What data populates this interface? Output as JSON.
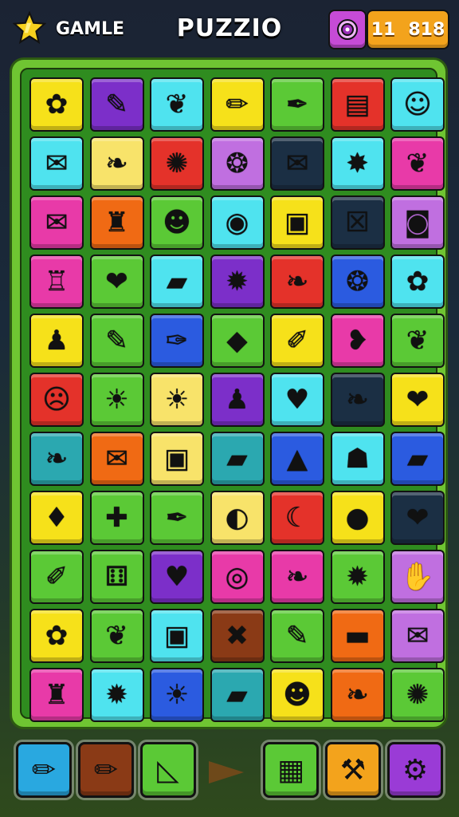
{
  "header": {
    "app_label": "GAMLE",
    "title": "PUZZIO",
    "score_left": "11",
    "score_right": "818",
    "star_icon": "star-icon",
    "ring_icon": "ring-target-icon"
  },
  "colors": {
    "yellow": "#f6e11a",
    "purple": "#7c2fc9",
    "cyan": "#4fe3ef",
    "green": "#5bc936",
    "red": "#e4322a",
    "orange": "#f06a14",
    "blue": "#2b5be0",
    "magenta": "#e83aa8",
    "navy": "#1b2f44",
    "teal": "#2ba8b0",
    "lavender": "#c06fe0",
    "cream": "#f8e36a",
    "brown": "#8a3a16",
    "lime": "#7fd93a"
  },
  "board": {
    "rows": [
      [
        {
          "c": "yellow",
          "i": "flower-icon",
          "g": "✿"
        },
        {
          "c": "purple",
          "i": "crayon-icon",
          "g": "✎"
        },
        {
          "c": "cyan",
          "i": "berries-icon",
          "g": "❦"
        },
        {
          "c": "yellow",
          "i": "pencil-icon",
          "g": "✏"
        },
        {
          "c": "green",
          "i": "marker-icon",
          "g": "✒"
        },
        {
          "c": "red",
          "i": "chart-card-icon",
          "g": "▤"
        },
        {
          "c": "cyan",
          "i": "smile-face-icon",
          "g": "☺"
        }
      ],
      [
        {
          "c": "cyan",
          "i": "envelope-icon",
          "g": "✉"
        },
        {
          "c": "cream",
          "i": "leaf-sprout-icon",
          "g": "❧"
        },
        {
          "c": "red",
          "i": "sun-flower-icon",
          "g": "✺"
        },
        {
          "c": "lavender",
          "i": "fruit-icon",
          "g": "❂"
        },
        {
          "c": "navy",
          "i": "envelope-open-icon",
          "g": "✉"
        },
        {
          "c": "cyan",
          "i": "starburst-icon",
          "g": "✸"
        },
        {
          "c": "magenta",
          "i": "leaf-cluster-icon",
          "g": "❦"
        }
      ],
      [
        {
          "c": "magenta",
          "i": "mail-icon",
          "g": "✉"
        },
        {
          "c": "orange",
          "i": "cake-stand-icon",
          "g": "♜"
        },
        {
          "c": "green",
          "i": "onion-face-icon",
          "g": "☻"
        },
        {
          "c": "cyan",
          "i": "target-icon",
          "g": "◉"
        },
        {
          "c": "yellow",
          "i": "ring-icon",
          "g": "▣"
        },
        {
          "c": "navy",
          "i": "crate-icon",
          "g": "☒"
        },
        {
          "c": "lavender",
          "i": "camera-icon",
          "g": "◙"
        }
      ],
      [
        {
          "c": "magenta",
          "i": "bottles-icon",
          "g": "♖"
        },
        {
          "c": "green",
          "i": "strawberry-icon",
          "g": "❤"
        },
        {
          "c": "cyan",
          "i": "eraser-icon",
          "g": "▰"
        },
        {
          "c": "purple",
          "i": "bug-icon",
          "g": "✹"
        },
        {
          "c": "red",
          "i": "leaf-icon",
          "g": "❧"
        },
        {
          "c": "blue",
          "i": "pumpkin-icon",
          "g": "❂"
        },
        {
          "c": "cyan",
          "i": "gear-flower-icon",
          "g": "✿"
        }
      ],
      [
        {
          "c": "yellow",
          "i": "bottle-icon",
          "g": "♟"
        },
        {
          "c": "green",
          "i": "crayon-icon",
          "g": "✎"
        },
        {
          "c": "blue",
          "i": "feather-icon",
          "g": "✑"
        },
        {
          "c": "green",
          "i": "gem-icon",
          "g": "◆"
        },
        {
          "c": "yellow",
          "i": "brush-icon",
          "g": "✐"
        },
        {
          "c": "magenta",
          "i": "radish-icon",
          "g": "❥"
        },
        {
          "c": "green",
          "i": "veggie-icon",
          "g": "❦"
        }
      ],
      [
        {
          "c": "red",
          "i": "robot-face-icon",
          "g": "☹"
        },
        {
          "c": "green",
          "i": "sun-icon",
          "g": "☀"
        },
        {
          "c": "cream",
          "i": "sun-icon",
          "g": "☀"
        },
        {
          "c": "purple",
          "i": "glue-bottle-icon",
          "g": "♟"
        },
        {
          "c": "cyan",
          "i": "heart-fruit-icon",
          "g": "♥"
        },
        {
          "c": "navy",
          "i": "pepper-icon",
          "g": "❧"
        },
        {
          "c": "yellow",
          "i": "strawberry-icon",
          "g": "❤"
        }
      ],
      [
        {
          "c": "teal",
          "i": "pepper-icon",
          "g": "❧"
        },
        {
          "c": "orange",
          "i": "ticket-icon",
          "g": "✉"
        },
        {
          "c": "cream",
          "i": "gift-box-icon",
          "g": "▣"
        },
        {
          "c": "teal",
          "i": "chalk-icon",
          "g": "▰"
        },
        {
          "c": "blue",
          "i": "cone-icon",
          "g": "▲"
        },
        {
          "c": "cyan",
          "i": "bag-icon",
          "g": "☗"
        },
        {
          "c": "blue",
          "i": "ruler-icon",
          "g": "▰"
        }
      ],
      [
        {
          "c": "yellow",
          "i": "onion-icon",
          "g": "♦"
        },
        {
          "c": "green",
          "i": "puzzle-piece-icon",
          "g": "✚"
        },
        {
          "c": "green",
          "i": "paintbrush-icon",
          "g": "✒"
        },
        {
          "c": "cream",
          "i": "snail-icon",
          "g": "◐"
        },
        {
          "c": "red",
          "i": "banana-icon",
          "g": "☾"
        },
        {
          "c": "yellow",
          "i": "peach-icon",
          "g": "●"
        },
        {
          "c": "navy",
          "i": "strawberry-icon",
          "g": "❤"
        }
      ],
      [
        {
          "c": "green",
          "i": "paint-brush-icon",
          "g": "✐"
        },
        {
          "c": "green",
          "i": "dice-icon",
          "g": "⚅"
        },
        {
          "c": "purple",
          "i": "heart-fruit-icon",
          "g": "♥"
        },
        {
          "c": "magenta",
          "i": "spiral-icon",
          "g": "◎"
        },
        {
          "c": "magenta",
          "i": "pear-icon",
          "g": "❧"
        },
        {
          "c": "green",
          "i": "gear-icon",
          "g": "✹"
        },
        {
          "c": "lavender",
          "i": "glove-icon",
          "g": "✋"
        }
      ],
      [
        {
          "c": "yellow",
          "i": "flower-gear-icon",
          "g": "✿"
        },
        {
          "c": "green",
          "i": "berry-icon",
          "g": "❦"
        },
        {
          "c": "cyan",
          "i": "box-icon",
          "g": "▣"
        },
        {
          "c": "brown",
          "i": "cross-icon",
          "g": "✖"
        },
        {
          "c": "green",
          "i": "crayon-icon",
          "g": "✎"
        },
        {
          "c": "orange",
          "i": "disc-icon",
          "g": "▬"
        },
        {
          "c": "lavender",
          "i": "envelope-icon",
          "g": "✉"
        }
      ],
      [
        {
          "c": "magenta",
          "i": "basket-icon",
          "g": "♜"
        },
        {
          "c": "cyan",
          "i": "gear-icon",
          "g": "✹"
        },
        {
          "c": "blue",
          "i": "sun-icon",
          "g": "☀"
        },
        {
          "c": "teal",
          "i": "eraser-icon",
          "g": "▰"
        },
        {
          "c": "yellow",
          "i": "cookie-face-icon",
          "g": "☻"
        },
        {
          "c": "orange",
          "i": "leaf-icon",
          "g": "❧"
        },
        {
          "c": "green",
          "i": "red-flower-icon",
          "g": "✺"
        }
      ]
    ]
  },
  "toolbar": {
    "items": [
      {
        "c": "#29a8e0",
        "i": "pencil-red-icon",
        "g": "✏"
      },
      {
        "c": "#8a3a16",
        "i": "pencil-icon",
        "g": "✏"
      },
      {
        "c": "#5bc936",
        "i": "ruler-square-icon",
        "g": "◺"
      },
      {
        "c": "#5bc936",
        "i": "cash-register-icon",
        "g": "▦"
      },
      {
        "c": "#f3a31c",
        "i": "tools-icon",
        "g": "⚒"
      },
      {
        "c": "#9a3bd6",
        "i": "settings-gear-icon",
        "g": "⚙"
      }
    ],
    "arrow_icon": "arrow-right-icon"
  }
}
